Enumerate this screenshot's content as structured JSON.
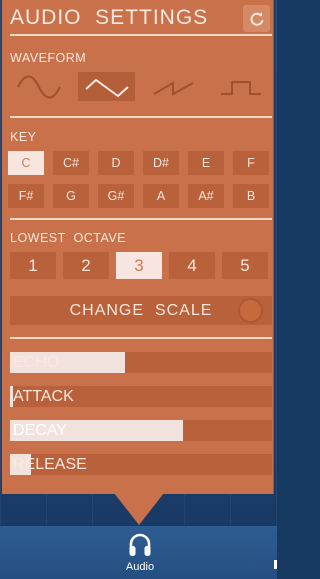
{
  "panel": {
    "title": "AUDIO  SETTINGS",
    "refresh_icon": "refresh-icon",
    "waveform": {
      "label": "WAVEFORM",
      "options": [
        {
          "name": "sine",
          "icon": "sine-wave-icon",
          "selected": false
        },
        {
          "name": "triangle",
          "icon": "triangle-wave-icon",
          "selected": true
        },
        {
          "name": "sawtooth",
          "icon": "sawtooth-wave-icon",
          "selected": false
        },
        {
          "name": "square",
          "icon": "square-wave-icon",
          "selected": false
        }
      ]
    },
    "key": {
      "label": "KEY",
      "notes": [
        "C",
        "C#",
        "D",
        "D#",
        "E",
        "F",
        "F#",
        "G",
        "G#",
        "A",
        "A#",
        "B"
      ],
      "selected": "C"
    },
    "octave": {
      "label": "LOWEST  OCTAVE",
      "options": [
        "1",
        "2",
        "3",
        "4",
        "5"
      ],
      "selected": "3"
    },
    "change_scale": {
      "label": "CHANGE  SCALE"
    },
    "envelope": [
      {
        "label": "ECHO",
        "level": 0.44
      },
      {
        "label": "ATTACK",
        "level": 0.01
      },
      {
        "label": "DECAY",
        "level": 0.66
      },
      {
        "label": "RELEASE",
        "level": 0.08
      }
    ]
  },
  "tabbar": {
    "active_tab": {
      "label": "Audio",
      "icon": "headphones-icon"
    }
  },
  "colors": {
    "panel": "#c9714a",
    "button": "#b9613b",
    "selected": "#f7e6e0",
    "selected_text": "#d07a55",
    "tabbar": "#2e5d93"
  }
}
